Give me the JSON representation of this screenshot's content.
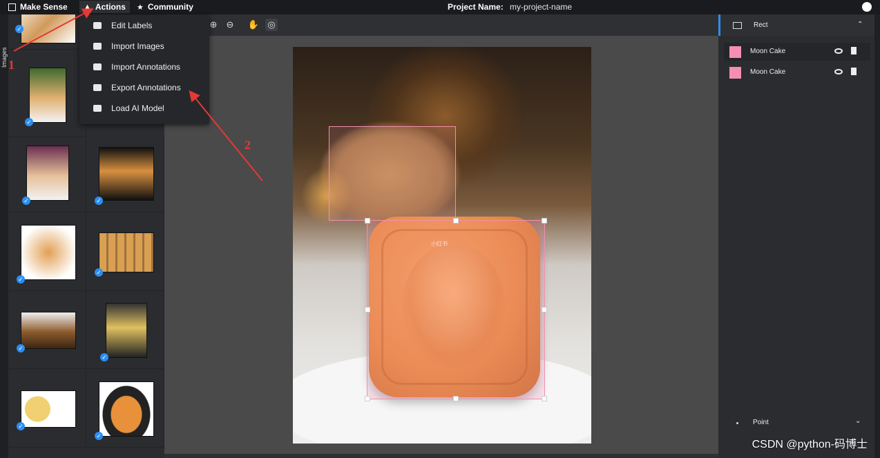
{
  "topbar": {
    "brand": "Make Sense",
    "actions": "Actions",
    "community": "Community",
    "project_label": "Project Name:",
    "project_value": "my-project-name"
  },
  "left_tab": {
    "label": "Images"
  },
  "actions_menu": {
    "items": [
      {
        "label": "Edit Labels",
        "icon": "tag-icon"
      },
      {
        "label": "Import Images",
        "icon": "camera-icon"
      },
      {
        "label": "Import Annotations",
        "icon": "file-import-icon"
      },
      {
        "label": "Export Annotations",
        "icon": "file-export-icon"
      },
      {
        "label": "Load AI Model",
        "icon": "ai-model-icon"
      }
    ]
  },
  "toolbar": {
    "tools": [
      "zoom-in-icon",
      "zoom-out-icon",
      "hand-icon",
      "crosshair-icon"
    ]
  },
  "image_overlay_text": "小红书",
  "right_panel": {
    "rect_section": {
      "label": "Rect"
    },
    "labels": [
      {
        "name": "Moon Cake",
        "color": "#f48fb1"
      },
      {
        "name": "Moon Cake",
        "color": "#f48fb1"
      }
    ],
    "point_section": {
      "label": "Point"
    }
  },
  "annotations": {
    "marker_1": "1",
    "marker_2": "2",
    "watermark": "CSDN @python-码博士"
  },
  "colors": {
    "accent": "#2a8ff5",
    "label_color": "#f48fb1",
    "arrow": "#e53935"
  }
}
